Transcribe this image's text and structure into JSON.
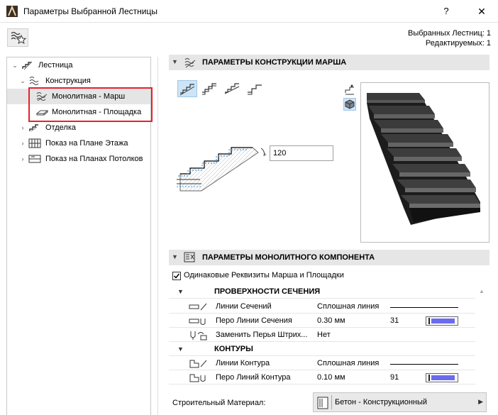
{
  "window": {
    "title": "Параметры Выбранной Лестницы",
    "help_label": "?",
    "close_label": "✕"
  },
  "status": {
    "selected": "Выбранных Лестниц: 1",
    "editable": "Редактируемых: 1"
  },
  "tree": {
    "items": [
      {
        "label": "Лестница",
        "icon": "stair-icon",
        "arrow": "⌄"
      },
      {
        "label": "Конструкция",
        "icon": "structure-icon",
        "arrow": "⌄"
      },
      {
        "label": "Монолитная - Марш",
        "icon": "monolithic-flight-icon",
        "arrow": ""
      },
      {
        "label": "Монолитная - Площадка",
        "icon": "monolithic-landing-icon",
        "arrow": ""
      },
      {
        "label": "Отделка",
        "icon": "finish-icon",
        "arrow": "›"
      },
      {
        "label": "Показ на Плане Этажа",
        "icon": "floor-plan-icon",
        "arrow": "›"
      },
      {
        "label": "Показ на Планах Потолков",
        "icon": "ceiling-plan-icon",
        "arrow": "›"
      }
    ]
  },
  "flight_section": {
    "title": "ПАРАМЕТРЫ КОНСТРУКЦИИ МАРША",
    "angle_value": "120",
    "structure_types": [
      "stepped-type-icon",
      "sawtooth-type-icon",
      "smooth-type-icon",
      "stepped-underside-type-icon"
    ]
  },
  "monolithic_section": {
    "title": "ПАРАМЕТРЫ МОНОЛИТНОГО КОМПОНЕНТА",
    "same_attributes_label": "Одинаковые Реквизиты Марша и Площадки",
    "same_attributes_checked": true
  },
  "grid": {
    "groups": [
      {
        "title": "ПРОВЕРХНОСТИ СЕЧЕНИЯ",
        "rows": [
          {
            "name": "Линии Сечений",
            "value": "Сплошная линия",
            "icon": "section-lines-icon"
          },
          {
            "name": "Перо Линии Сечения",
            "value": "0.30 мм",
            "pen": "31",
            "icon": "section-pen-icon"
          },
          {
            "name": "Заменить Перья Штрих...",
            "value": "Нет",
            "icon": "override-fill-pens-icon"
          }
        ]
      },
      {
        "title": "КОНТУРЫ",
        "rows": [
          {
            "name": "Линии Контура",
            "value": "Сплошная линия",
            "icon": "contour-lines-icon"
          },
          {
            "name": "Перо Линий Контура",
            "value": "0.10 мм",
            "pen": "91",
            "icon": "contour-pen-icon"
          }
        ]
      }
    ]
  },
  "material": {
    "label": "Строительный Материал:",
    "value": "Бетон - Конструкционный"
  },
  "colors": {
    "selection_box": "#e8202a",
    "pen_fill": "#6b6bf0",
    "header_bg": "#e6e6e6"
  }
}
